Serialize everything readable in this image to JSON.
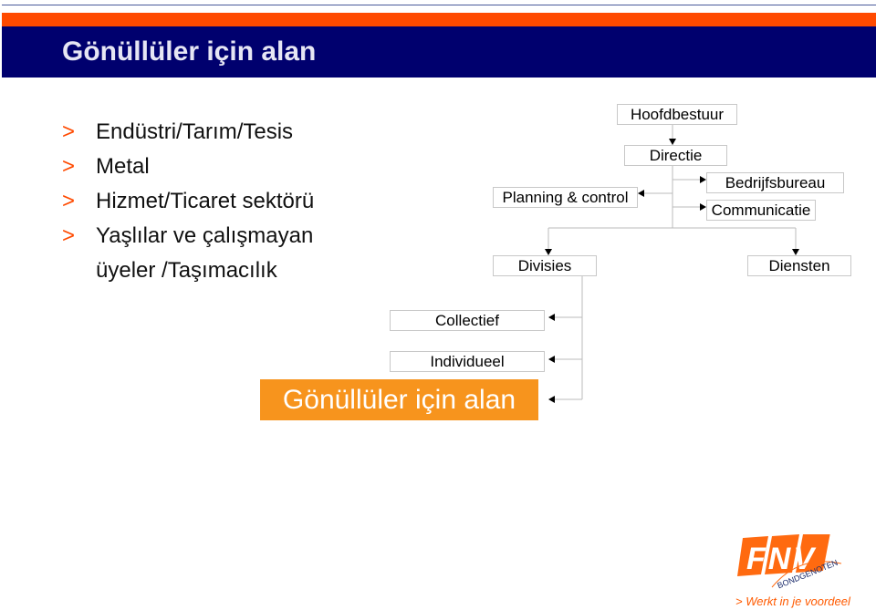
{
  "header": {
    "title": "Gönüllüler için alan"
  },
  "bullets": [
    {
      "marker": ">",
      "text": "Endüstri/Tarım/Tesis"
    },
    {
      "marker": ">",
      "text": "Metal"
    },
    {
      "marker": ">",
      "text": "Hizmet/Ticaret sektörü"
    },
    {
      "marker": ">",
      "text": "Yaşlılar ve çalışmayan"
    },
    {
      "marker": "",
      "text": "üyeler /Taşımacılık"
    }
  ],
  "org": {
    "hoofdbestuur": "Hoofdbestuur",
    "directie": "Directie",
    "bedrijfsbureau": "Bedrijfsbureau",
    "communicatie": "Communicatie",
    "planning": "Planning & control",
    "divisies": "Divisies",
    "diensten": "Diensten",
    "collectief": "Collectief",
    "individueel": "Individueel",
    "highlight": "Gönüllüler için alan"
  },
  "logo": {
    "text": "FNV",
    "sub": "BONDGENOTEN",
    "slogan": "> Werkt in je voordeel"
  },
  "colors": {
    "accent": "#ff4a00",
    "navy": "#00006e",
    "highlight": "#f7941d"
  }
}
